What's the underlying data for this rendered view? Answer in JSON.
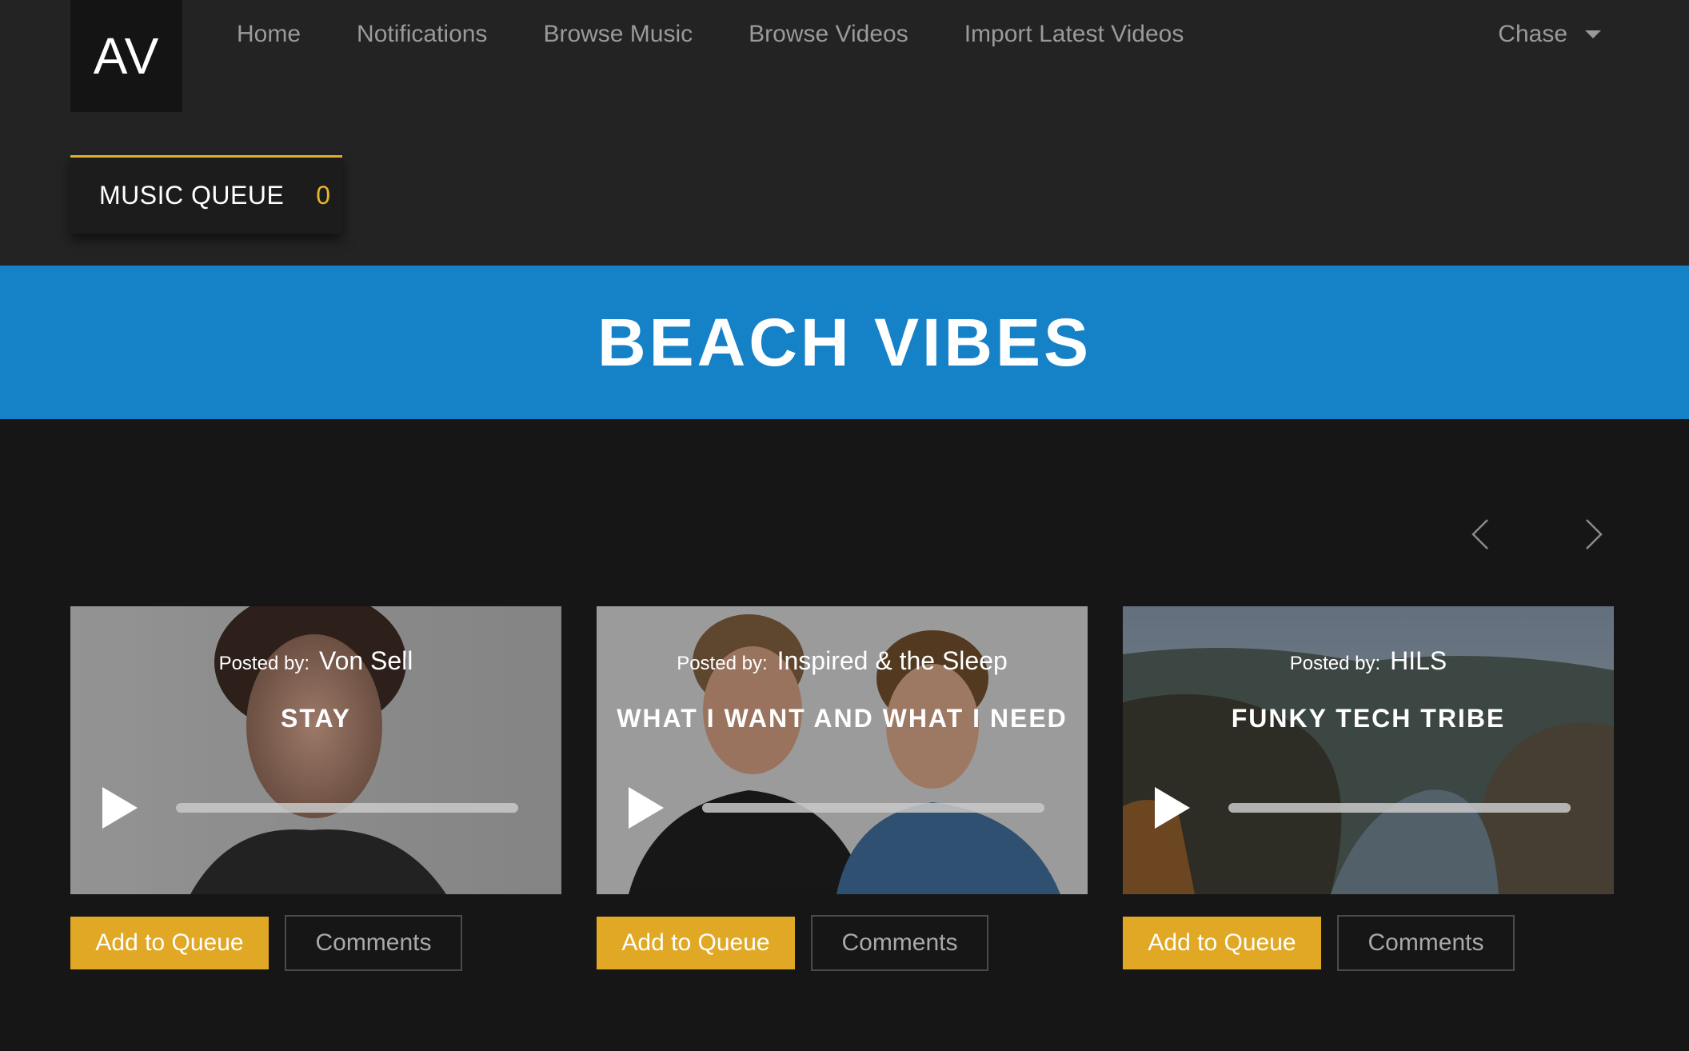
{
  "header": {
    "logo_text": "AV",
    "nav": [
      {
        "label": "Home"
      },
      {
        "label": "Notifications"
      },
      {
        "label": "Browse Music"
      },
      {
        "label": "Browse Videos"
      },
      {
        "label": "Import Latest Videos"
      }
    ],
    "user_name": "Chase"
  },
  "queue": {
    "label": "MUSIC QUEUE",
    "count": "0"
  },
  "banner": {
    "title": "BEACH VIBES"
  },
  "cards": [
    {
      "posted_prefix": "Posted by:",
      "artist": "Von Sell",
      "title": "STAY",
      "progress": 0,
      "add_label": "Add to Queue",
      "comments_label": "Comments",
      "image_icon": "portrait-photo"
    },
    {
      "posted_prefix": "Posted by:",
      "artist": "Inspired & the Sleep",
      "title": "WHAT I WANT AND WHAT I NEED",
      "progress": 0,
      "add_label": "Add to Queue",
      "comments_label": "Comments",
      "image_icon": "duo-photo"
    },
    {
      "posted_prefix": "Posted by:",
      "artist": "HILS",
      "title": "FUNKY TECH TRIBE",
      "progress": 0,
      "add_label": "Add to Queue",
      "comments_label": "Comments",
      "image_icon": "canyon-landscape-photo"
    }
  ],
  "colors": {
    "accent": "#e0a824",
    "banner": "#1581c6",
    "background": "#161616",
    "header": "#232323"
  }
}
